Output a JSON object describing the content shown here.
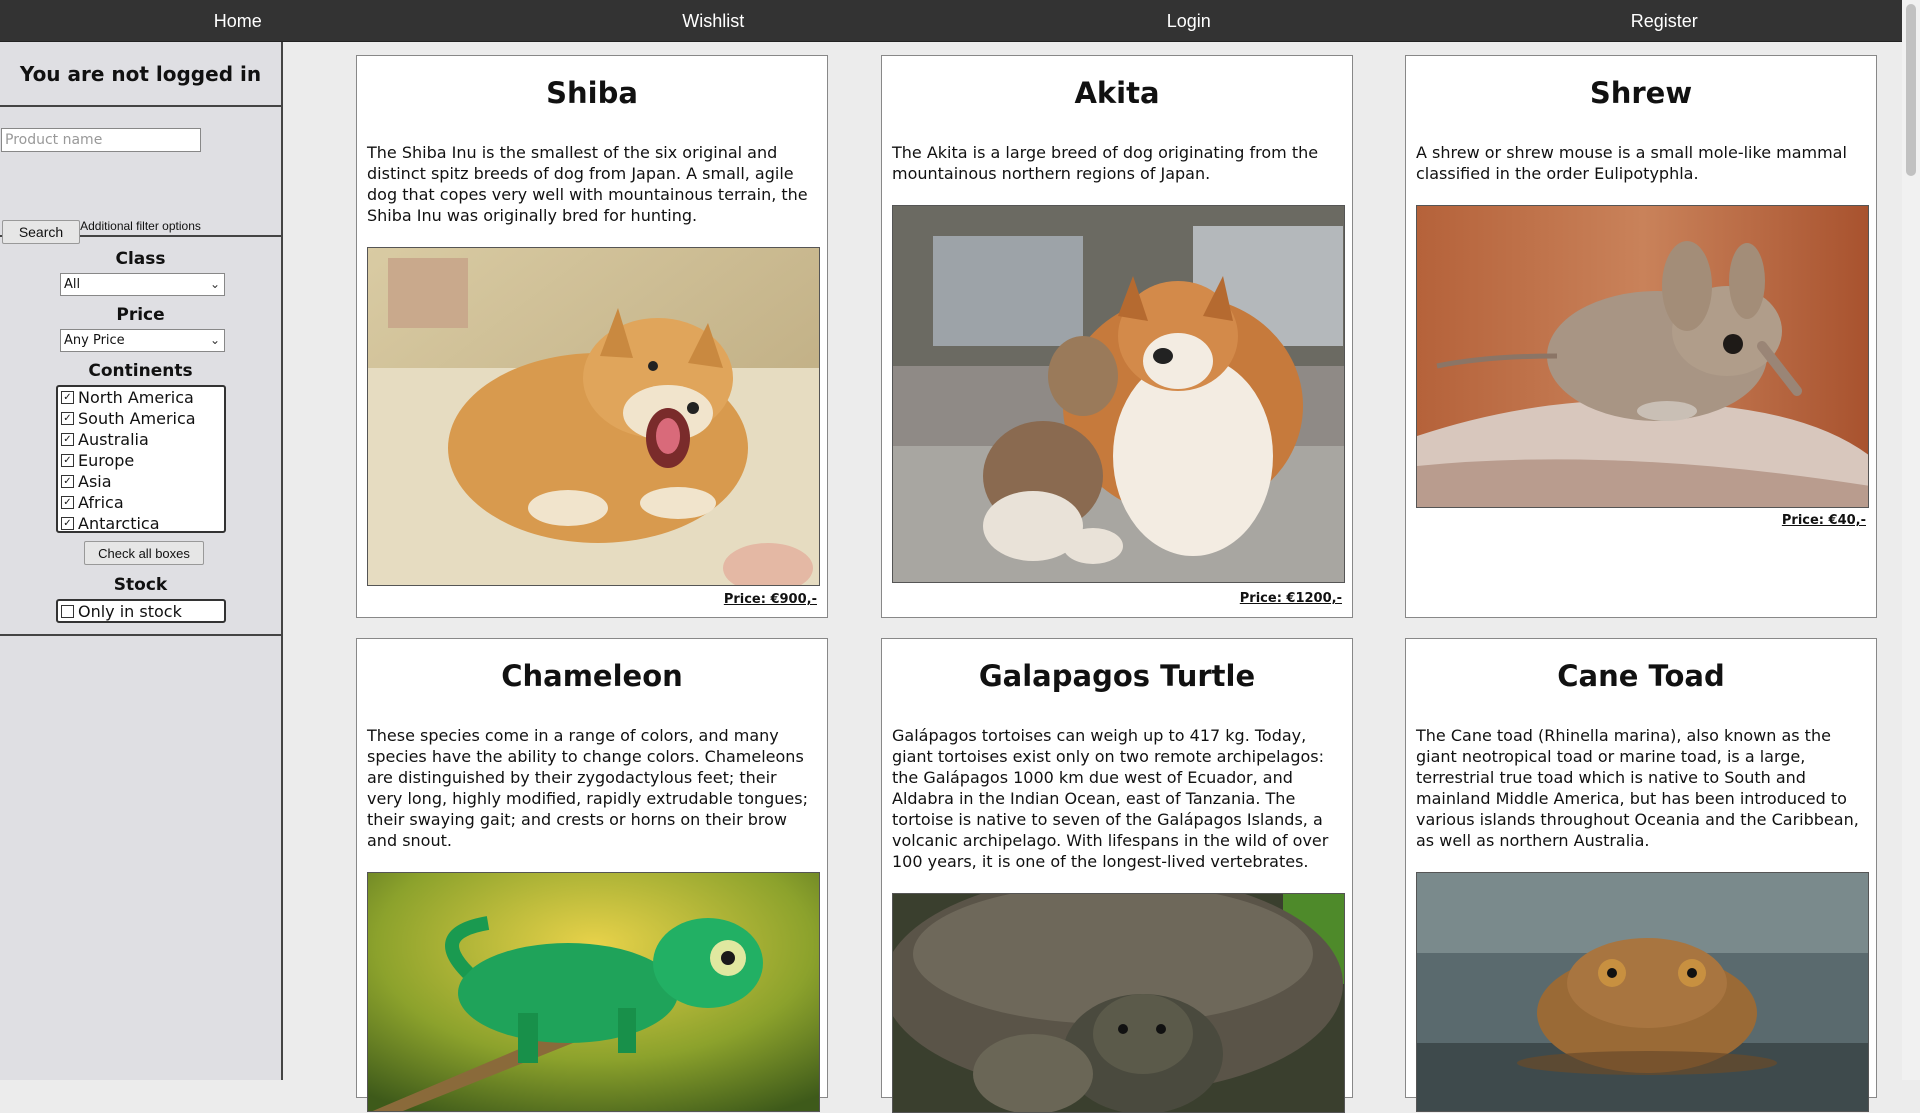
{
  "nav": {
    "items": [
      {
        "label": "Home"
      },
      {
        "label": "Wishlist"
      },
      {
        "label": "Login"
      },
      {
        "label": "Register"
      }
    ]
  },
  "sidebar": {
    "login_status": "You are not logged in",
    "search": {
      "placeholder": "Product name",
      "value": "",
      "button_label": "Search",
      "additional_label": "Additional filter options"
    },
    "filters": {
      "class_heading": "Class",
      "class_value": "All",
      "price_heading": "Price",
      "price_value": "Any Price",
      "continents_heading": "Continents",
      "continents": [
        {
          "label": "North America",
          "checked": true
        },
        {
          "label": "South America",
          "checked": true
        },
        {
          "label": "Australia",
          "checked": true
        },
        {
          "label": "Europe",
          "checked": true
        },
        {
          "label": "Asia",
          "checked": true
        },
        {
          "label": "Africa",
          "checked": true
        },
        {
          "label": "Antarctica",
          "checked": true
        }
      ],
      "check_all_label": "Check all boxes",
      "stock_heading": "Stock",
      "stock_option": {
        "label": "Only in stock",
        "checked": false
      }
    }
  },
  "products": [
    {
      "name": "Shiba",
      "description": "The Shiba Inu is the smallest of the six original and distinct spitz breeds of dog from Japan. A small, agile dog that copes very well with mountainous terrain, the Shiba Inu was originally bred for hunting.",
      "price": "Price: €900,-",
      "image": "shiba-dog-photo"
    },
    {
      "name": "Akita",
      "description": "The Akita is a large breed of dog originating from the mountainous northern regions of Japan.",
      "price": "Price: €1200,-",
      "image": "akita-dogs-photo"
    },
    {
      "name": "Shrew",
      "description": "A shrew or shrew mouse is a small mole-like mammal classified in the order Eulipotyphla.",
      "price": "Price: €40,-",
      "image": "shrew-photo"
    },
    {
      "name": "Chameleon",
      "description": "These species come in a range of colors, and many species have the ability to change colors. Chameleons are distinguished by their zygodactylous feet; their very long, highly modified, rapidly extrudable tongues; their swaying gait; and crests or horns on their brow and snout.",
      "price": "",
      "image": "chameleon-photo"
    },
    {
      "name": "Galapagos Turtle",
      "description": "Galápagos tortoises can weigh up to 417 kg. Today, giant tortoises exist only on two remote archipelagos: the Galápagos 1000 km due west of Ecuador, and Aldabra in the Indian Ocean, east of Tanzania. The tortoise is native to seven of the Galápagos Islands, a volcanic archipelago. With lifespans in the wild of over 100 years, it is one of the longest-lived vertebrates.",
      "price": "",
      "image": "galapagos-tortoise-photo"
    },
    {
      "name": "Cane Toad",
      "description": "The Cane toad (Rhinella marina), also known as the giant neotropical toad or marine toad, is a large, terrestrial true toad which is native to South and mainland Middle America, but has been introduced to various islands throughout Oceania and the Caribbean, as well as northern Australia.",
      "price": "",
      "image": "cane-toad-photo"
    }
  ]
}
